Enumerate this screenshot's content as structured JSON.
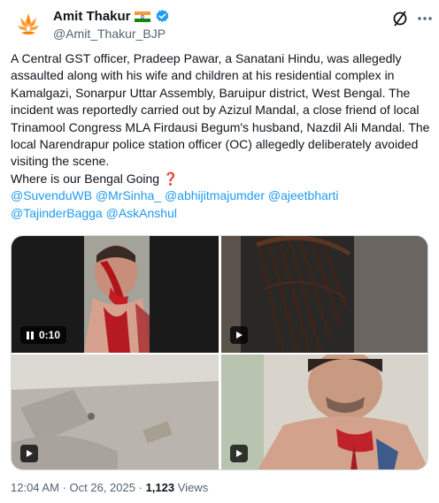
{
  "author": {
    "display_name": "Amit Thakur",
    "handle": "@Amit_Thakur_BJP",
    "avatar_icon": "saffron-lotus-icon",
    "flag_icon": "india-flag-icon",
    "verified_icon": "verified-badge-icon"
  },
  "header_actions": {
    "grok_icon": "grok-slash-icon",
    "more_icon": "more-horizontal-icon"
  },
  "tweet": {
    "text": "A Central GST officer, Pradeep Pawar, a Sanatani Hindu, was allegedly assaulted along with his wife and children at his residential complex in Kamalgazi, Sonarpur Uttar Assembly, Baruipur district, West Bengal. The incident was reportedly carried out by Azizul Mandal, a close friend of local Trinamool Congress MLA Firdausi Begum's husband, Nazdil Ali Mandal. The local Narendrapur police station officer (OC) allegedly deliberately avoided visiting the scene.",
    "question_line": "Where is our Bengal Going",
    "question_emoji": "❓",
    "mentions": [
      "@SuvenduWB",
      "@MrSinha_",
      "@abhijitmajumder",
      "@ajeetbharti",
      "@TajinderBagga",
      "@AskAnshul"
    ]
  },
  "media": [
    {
      "type": "video",
      "state": "paused",
      "timer": "0:10",
      "icon": "pause-icon"
    },
    {
      "type": "video",
      "icon": "play-icon"
    },
    {
      "type": "video",
      "icon": "play-icon"
    },
    {
      "type": "video",
      "icon": "play-icon"
    }
  ],
  "meta": {
    "time": "12:04 AM",
    "separator": "·",
    "date": "Oct 26, 2025",
    "views_count": "1,123",
    "views_label": "Views"
  },
  "colors": {
    "link": "#1d9bf0",
    "text": "#0f1419",
    "secondary": "#536471",
    "verified": "#1d9bf0",
    "question": "#e0245e"
  }
}
